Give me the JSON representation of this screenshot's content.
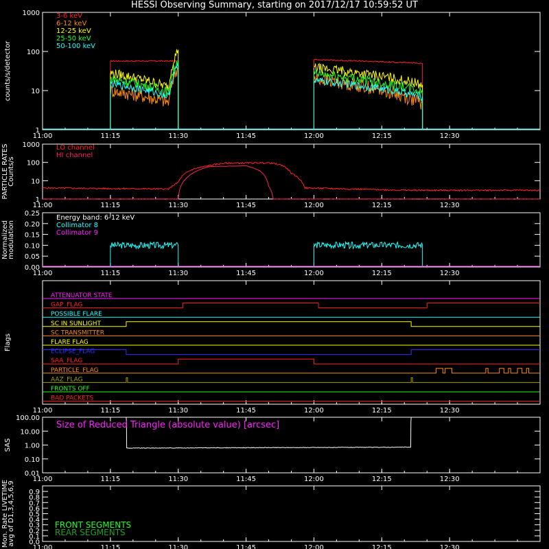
{
  "title": "HESSI Observing Summary, starting on 2017/12/17 10:59:52 UT",
  "time_ticks": [
    "11:00",
    "11:15",
    "11:30",
    "11:45",
    "12:00",
    "12:15",
    "12:30"
  ],
  "colors": {
    "red": "#ff2020",
    "orange": "#ff8c00",
    "yellow": "#ffff00",
    "green": "#20ff20",
    "cyan": "#20ffff",
    "magenta": "#ff20ff",
    "crimson": "#ff2060",
    "white": "#ffffff",
    "blue": "#3030ff",
    "olive": "#a0a000",
    "dkred": "#cc1010",
    "dkgreen": "#20a020"
  },
  "chart_data": [
    {
      "type": "line",
      "ylabel": "counts/s/detector",
      "yscale": "log",
      "ylim": [
        1,
        1000
      ],
      "yticks": [
        "1",
        "10",
        "100",
        "1000"
      ],
      "xlim_min": [
        0,
        110
      ],
      "legend_position": "top-left",
      "series": [
        {
          "name": "3-6 keV",
          "color": "red",
          "segments": [
            [
              [
                15,
                57
              ],
              [
                30,
                57
              ]
            ],
            [
              [
                60,
                62
              ],
              [
                84,
                50
              ]
            ]
          ]
        },
        {
          "name": "6-12 keV",
          "color": "orange",
          "segments": [
            [
              [
                15,
                10
              ],
              [
                28,
                5
              ],
              [
                30,
                40
              ]
            ],
            [
              [
                60,
                20
              ],
              [
                84,
                4.5
              ]
            ]
          ]
        },
        {
          "name": "12-25 keV",
          "color": "yellow",
          "segments": [
            [
              [
                15,
                28
              ],
              [
                28,
                12
              ],
              [
                30,
                110
              ]
            ],
            [
              [
                60,
                38
              ],
              [
                84,
                14
              ]
            ]
          ]
        },
        {
          "name": "25-50 keV",
          "color": "green",
          "segments": [
            [
              [
                15,
                20
              ],
              [
                28,
                9
              ],
              [
                30,
                60
              ]
            ],
            [
              [
                60,
                27
              ],
              [
                84,
                9
              ]
            ]
          ]
        },
        {
          "name": "50-100 keV",
          "color": "cyan",
          "segments": [
            [
              [
                15,
                15
              ],
              [
                28,
                7
              ],
              [
                30,
                45
              ]
            ],
            [
              [
                60,
                18
              ],
              [
                84,
                7
              ]
            ]
          ]
        }
      ]
    },
    {
      "type": "line",
      "ylabel": "PARTICLE RATES Counts/s",
      "yscale": "log",
      "ylim": [
        1,
        1000
      ],
      "yticks": [
        "1",
        "10",
        "100",
        "1000"
      ],
      "legend_position": "top-left",
      "series": [
        {
          "name": "LO channel",
          "color": "red",
          "points": [
            [
              0,
              4
            ],
            [
              28,
              3.5
            ],
            [
              30,
              8
            ],
            [
              33,
              40
            ],
            [
              40,
              90
            ],
            [
              50,
              95
            ],
            [
              53,
              70
            ],
            [
              55,
              25
            ],
            [
              58,
              4
            ],
            [
              80,
              3
            ],
            [
              110,
              3
            ]
          ]
        },
        {
          "name": "HI channel",
          "color": "crimson",
          "points": [
            [
              0,
              1
            ],
            [
              30,
              1
            ],
            [
              32,
              15
            ],
            [
              37,
              60
            ],
            [
              45,
              65
            ],
            [
              48,
              35
            ],
            [
              50,
              5
            ],
            [
              51,
              1
            ],
            [
              110,
              1
            ]
          ]
        }
      ]
    },
    {
      "type": "line",
      "ylabel": "Normalized modulation",
      "ylim": [
        0,
        0.25
      ],
      "yticks": [
        "0.00",
        "0.05",
        "0.10",
        "0.15",
        "0.20",
        "0.25"
      ],
      "legend_position": "top-left",
      "legend_header": "Energy band: 6-12 keV",
      "series": [
        {
          "name": "Collimator 8",
          "color": "cyan",
          "level": 0.1,
          "segments": [
            [
              15,
              30
            ],
            [
              60,
              84
            ]
          ]
        },
        {
          "name": "Collimator 9",
          "color": "magenta",
          "level": 0.0,
          "segments": [
            [
              0,
              110
            ]
          ]
        }
      ]
    },
    {
      "type": "table",
      "ylabel": "Flags",
      "flags": [
        {
          "name": "ATTENUATOR STATE",
          "color": "magenta",
          "transitions": [
            [
              0,
              0
            ]
          ]
        },
        {
          "name": "GAP_FLAG",
          "color": "red",
          "transitions": [
            [
              0,
              0
            ],
            [
              31,
              1
            ],
            [
              61,
              0
            ],
            [
              85,
              1
            ]
          ]
        },
        {
          "name": "POSSIBLE FLARE",
          "color": "cyan",
          "transitions": [
            [
              0,
              0
            ]
          ]
        },
        {
          "name": "SC IN SUNLIGHT",
          "color": "yellow",
          "transitions": [
            [
              0,
              0
            ],
            [
              18.5,
              1
            ],
            [
              81.5,
              0
            ]
          ]
        },
        {
          "name": "SC TRANSMITTER",
          "color": "orange",
          "transitions": [
            [
              0,
              0
            ]
          ]
        },
        {
          "name": "FLARE FLAG",
          "color": "yellow",
          "transitions": [
            [
              0,
              0
            ]
          ]
        },
        {
          "name": "ECLIPSE_FLAG",
          "color": "blue",
          "transitions": [
            [
              0,
              1
            ],
            [
              18.5,
              0
            ],
            [
              81.5,
              1
            ]
          ]
        },
        {
          "name": "SAA_FLAG",
          "color": "red",
          "transitions": [
            [
              0,
              0
            ],
            [
              30,
              1
            ],
            [
              60,
              0
            ]
          ]
        },
        {
          "name": "PARTICLE_FLAG",
          "color": "orange",
          "transitions": [
            [
              0,
              0
            ],
            [
              87,
              1
            ],
            [
              88.5,
              0
            ],
            [
              89,
              1
            ],
            [
              90.5,
              0
            ],
            [
              98,
              1
            ],
            [
              98.5,
              0
            ],
            [
              101,
              1
            ],
            [
              102,
              0
            ],
            [
              103,
              1
            ],
            [
              103.5,
              0
            ],
            [
              105,
              1
            ],
            [
              106,
              0
            ],
            [
              107,
              1
            ],
            [
              107.5,
              0
            ]
          ]
        },
        {
          "name": "AAZ_FLAG",
          "color": "olive",
          "transitions": [
            [
              0,
              0
            ],
            [
              18.5,
              1
            ],
            [
              18.8,
              0
            ],
            [
              81.5,
              1
            ],
            [
              81.8,
              0
            ]
          ]
        },
        {
          "name": "FRONTS OFF",
          "color": "green",
          "transitions": [
            [
              0,
              0
            ]
          ]
        },
        {
          "name": "BAD PACKETS",
          "color": "red",
          "transitions": [
            [
              0,
              0
            ]
          ]
        }
      ]
    },
    {
      "type": "line",
      "ylabel": "SAS",
      "yscale": "log",
      "ylim": [
        0.01,
        100
      ],
      "yticks": [
        "0.01",
        "0.10",
        "1.00",
        "10.00",
        "100.00"
      ],
      "annotation": "Size of Reduced Triangle (absolute value) [arcsec]",
      "series": [
        {
          "color": "white",
          "points": [
            [
              18.5,
              100
            ],
            [
              18.6,
              0.6
            ],
            [
              81.4,
              0.7
            ],
            [
              81.5,
              100
            ]
          ]
        }
      ]
    },
    {
      "type": "line",
      "ylabel": "Mon. Rate LIVETIME avg of D1,3,4,5,6,9",
      "ylim": [
        0,
        1
      ],
      "yticks": [
        "0.0",
        "0.1",
        "0.2",
        "0.3",
        "0.4",
        "0.5",
        "0.6",
        "0.7",
        "0.8",
        "0.9"
      ],
      "legend_position": "bottom-left",
      "series": [
        {
          "name": "FRONT SEGMENTS",
          "color": "green",
          "points": []
        },
        {
          "name": "REAR SEGMENTS",
          "color": "dkgreen",
          "points": []
        }
      ]
    }
  ]
}
